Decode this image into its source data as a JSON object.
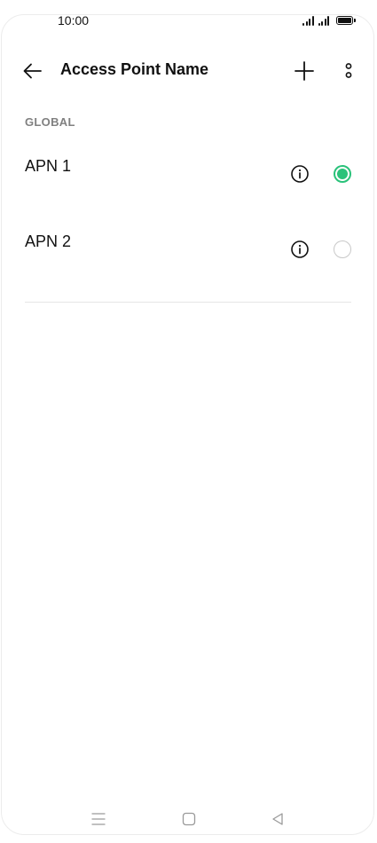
{
  "status_bar": {
    "time": "10:00"
  },
  "header": {
    "title": "Access Point Name",
    "back_icon": "arrow-left-icon",
    "add_icon": "plus-icon",
    "more_icon": "more-vertical-icon"
  },
  "section": {
    "label": "GLOBAL"
  },
  "apns": [
    {
      "label": "APN 1",
      "selected": true
    },
    {
      "label": "APN 2",
      "selected": false
    }
  ],
  "colors": {
    "accent": "#2ac27a",
    "section_label": "#808080",
    "radio_off": "#c8c8c8"
  }
}
